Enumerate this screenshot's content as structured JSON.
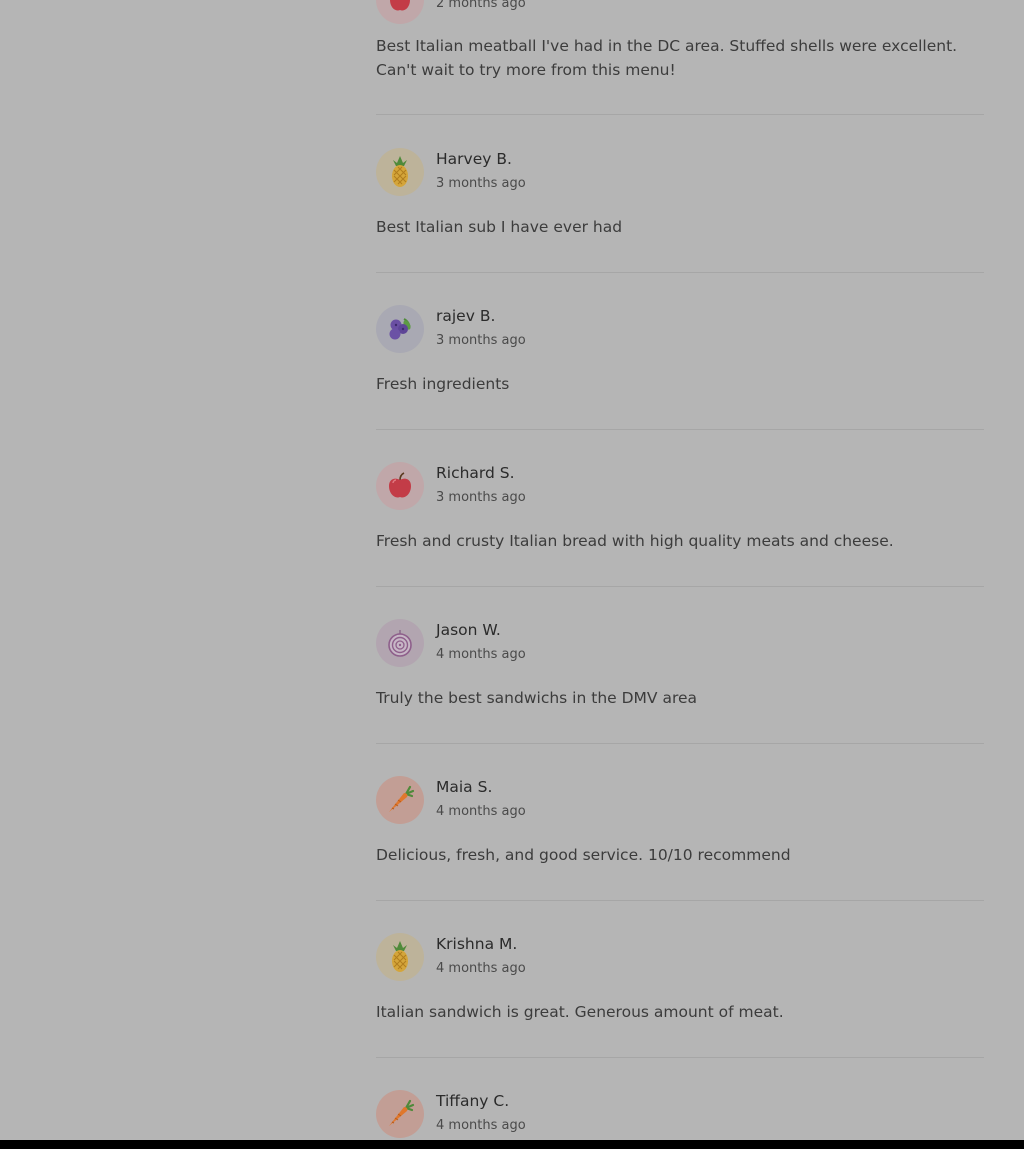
{
  "reviews": [
    {
      "avatar": "apple-icon",
      "name": "",
      "time": "2 months ago",
      "text": "Best Italian meatball I've had in the DC area. Stuffed shells were excellent. Can't wait to try more from this menu!"
    },
    {
      "avatar": "pineapple-icon",
      "name": "Harvey B.",
      "time": "3 months ago",
      "text": "Best Italian sub I have ever had"
    },
    {
      "avatar": "blueberries-icon",
      "name": "rajev B.",
      "time": "3 months ago",
      "text": "Fresh ingredients"
    },
    {
      "avatar": "apple-icon",
      "name": "Richard S.",
      "time": "3 months ago",
      "text": "Fresh and crusty Italian bread with high quality meats and cheese."
    },
    {
      "avatar": "onion-icon",
      "name": "Jason W.",
      "time": "4 months ago",
      "text": "Truly the best sandwichs in the DMV area"
    },
    {
      "avatar": "carrot-icon",
      "name": "Maia S.",
      "time": "4 months ago",
      "text": "Delicious, fresh, and good service. 10/10 recommend"
    },
    {
      "avatar": "pineapple-icon",
      "name": "Krishna M.",
      "time": "4 months ago",
      "text": "Italian sandwich is great. Generous amount of meat."
    },
    {
      "avatar": "carrot-icon",
      "name": "Tiffany C.",
      "time": "4 months ago",
      "text": ""
    }
  ],
  "colors": {
    "page_background": "#b5b5b5",
    "divider": "#a6a6a6",
    "apple_bg": "#c0a7a9",
    "pineapple_bg": "#bdb39a",
    "blueberries_bg": "#a9a9b3",
    "onion_bg": "#b2a5b0",
    "carrot_bg": "#c29e95"
  }
}
